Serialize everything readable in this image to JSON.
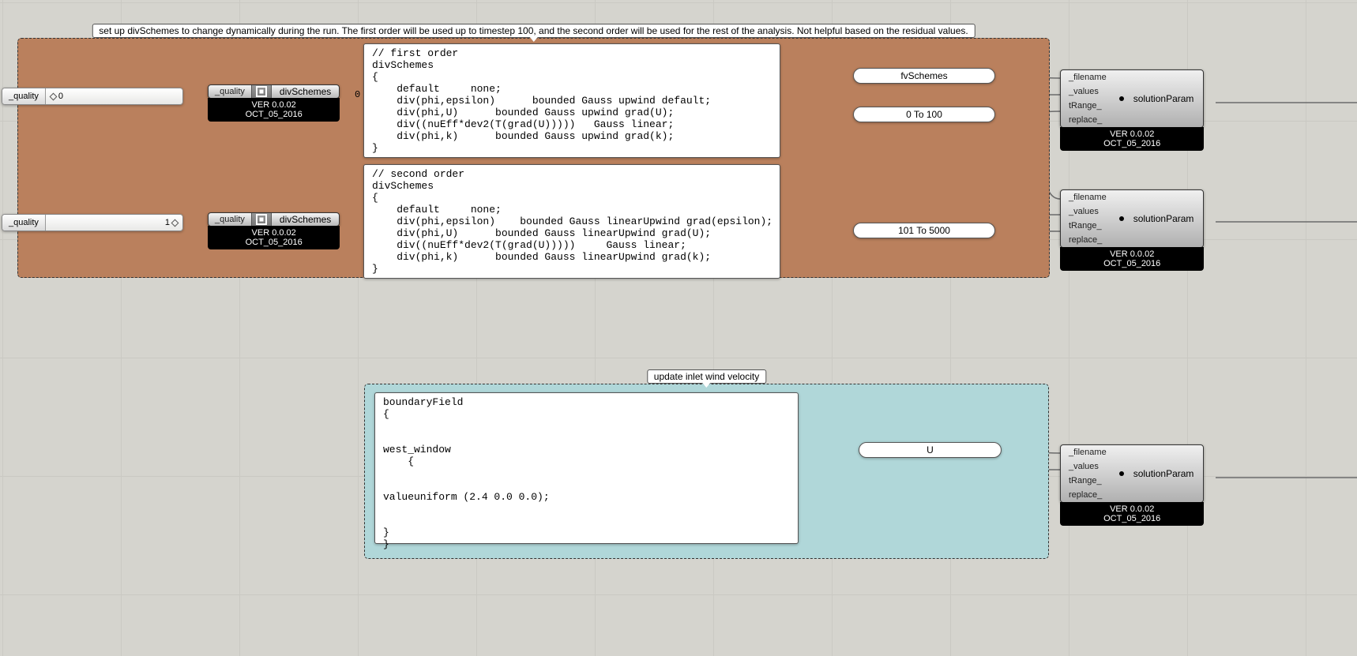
{
  "group1": {
    "label": "set up divSchemes to change dynamically during the run. The first order will be used up to timestep 100, and the second order will be used for the rest of the analysis. Not helpful based on the residual values."
  },
  "group2": {
    "label": "update inlet wind velocity"
  },
  "slider1": {
    "label": "_quality",
    "value": "0"
  },
  "slider2": {
    "label": "_quality",
    "value": "1"
  },
  "divNode1": {
    "in": "_quality",
    "out": "divSchemes",
    "ver": "VER 0.0.02",
    "date": "OCT_05_2016"
  },
  "divNode2": {
    "in": "_quality",
    "out": "divSchemes",
    "ver": "VER 0.0.02",
    "date": "OCT_05_2016"
  },
  "panel1_portnum": "0",
  "panel1": "// first order\ndivSchemes\n{\n    default     none;\n    div(phi,epsilon)      bounded Gauss upwind default;\n    div(phi,U)      bounded Gauss upwind grad(U);\n    div((nuEff*dev2(T(grad(U)))))   Gauss linear;\n    div(phi,k)      bounded Gauss upwind grad(k);\n}",
  "panel2": "// second order\ndivSchemes\n{\n    default     none;\n    div(phi,epsilon)    bounded Gauss linearUpwind grad(epsilon);\n    div(phi,U)      bounded Gauss linearUpwind grad(U);\n    div((nuEff*dev2(T(grad(U)))))     Gauss linear;\n    div(phi,k)      bounded Gauss linearUpwind grad(k);\n}",
  "panel3": "boundaryField\n{\n\n\nwest_window\n    {\n\n\nvalueuniform (2.4 0.0 0.0);\n\n\n}\n}",
  "pill_fv": "fvSchemes",
  "pill_range1": "0 To 100",
  "pill_range2": "101 To 5000",
  "pill_u": "U",
  "sp": {
    "filename": "_filename",
    "values": "_values",
    "trange": "tRange_",
    "replace": "replace_",
    "out": "solutionParam",
    "ver": "VER 0.0.02",
    "date": "OCT_05_2016"
  }
}
